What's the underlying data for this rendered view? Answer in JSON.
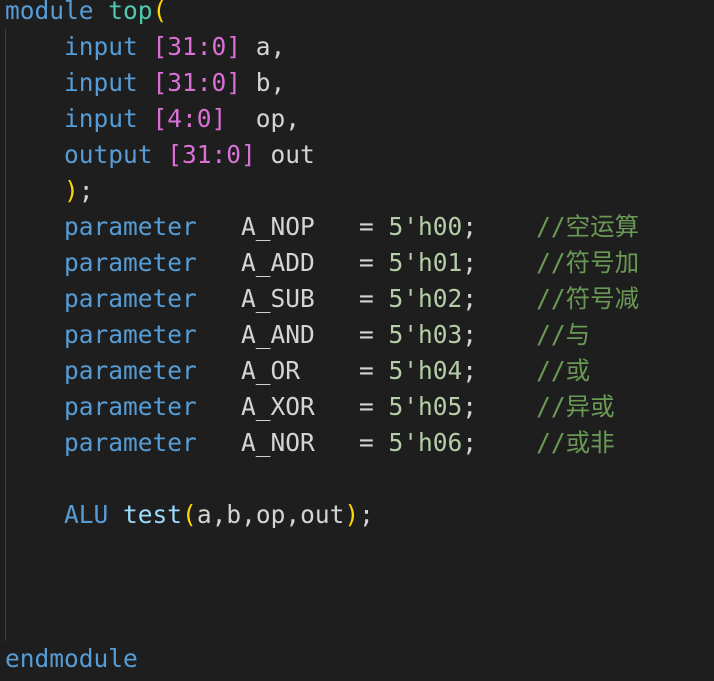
{
  "editor": {
    "lines": [
      {
        "tokens": [
          {
            "text": "module ",
            "color": "#569cd6"
          },
          {
            "text": "top",
            "color": "#4ec9b0"
          },
          {
            "text": "(",
            "color": "#ffd700"
          }
        ]
      },
      {
        "tokens": [
          {
            "text": "    input ",
            "color": "#569cd6"
          },
          {
            "text": "[31:0]",
            "color": "#da70d6"
          },
          {
            "text": " a,",
            "color": "#d4d4d4"
          }
        ]
      },
      {
        "tokens": [
          {
            "text": "    input ",
            "color": "#569cd6"
          },
          {
            "text": "[31:0]",
            "color": "#da70d6"
          },
          {
            "text": " b,",
            "color": "#d4d4d4"
          }
        ]
      },
      {
        "tokens": [
          {
            "text": "    input ",
            "color": "#569cd6"
          },
          {
            "text": "[4:0]",
            "color": "#da70d6"
          },
          {
            "text": "  op,",
            "color": "#d4d4d4"
          }
        ]
      },
      {
        "tokens": [
          {
            "text": "    output ",
            "color": "#569cd6"
          },
          {
            "text": "[31:0]",
            "color": "#da70d6"
          },
          {
            "text": " out",
            "color": "#d4d4d4"
          }
        ]
      },
      {
        "tokens": [
          {
            "text": "    )",
            "color": "#ffd700"
          },
          {
            "text": ";",
            "color": "#d4d4d4"
          }
        ]
      },
      {
        "tokens": [
          {
            "text": "    parameter",
            "color": "#569cd6"
          },
          {
            "text": "   A_NOP   = ",
            "color": "#d4d4d4"
          },
          {
            "text": "5'h00",
            "color": "#b5cea8"
          },
          {
            "text": ";    ",
            "color": "#d4d4d4"
          },
          {
            "text": "//空运算",
            "color": "#6a9955"
          }
        ]
      },
      {
        "tokens": [
          {
            "text": "    parameter",
            "color": "#569cd6"
          },
          {
            "text": "   A_ADD   = ",
            "color": "#d4d4d4"
          },
          {
            "text": "5'h01",
            "color": "#b5cea8"
          },
          {
            "text": ";    ",
            "color": "#d4d4d4"
          },
          {
            "text": "//符号加",
            "color": "#6a9955"
          }
        ]
      },
      {
        "tokens": [
          {
            "text": "    parameter",
            "color": "#569cd6"
          },
          {
            "text": "   A_SUB   = ",
            "color": "#d4d4d4"
          },
          {
            "text": "5'h02",
            "color": "#b5cea8"
          },
          {
            "text": ";    ",
            "color": "#d4d4d4"
          },
          {
            "text": "//符号减",
            "color": "#6a9955"
          }
        ]
      },
      {
        "tokens": [
          {
            "text": "    parameter",
            "color": "#569cd6"
          },
          {
            "text": "   A_AND   = ",
            "color": "#d4d4d4"
          },
          {
            "text": "5'h03",
            "color": "#b5cea8"
          },
          {
            "text": ";    ",
            "color": "#d4d4d4"
          },
          {
            "text": "//与",
            "color": "#6a9955"
          }
        ]
      },
      {
        "tokens": [
          {
            "text": "    parameter",
            "color": "#569cd6"
          },
          {
            "text": "   A_OR    = ",
            "color": "#d4d4d4"
          },
          {
            "text": "5'h04",
            "color": "#b5cea8"
          },
          {
            "text": ";    ",
            "color": "#d4d4d4"
          },
          {
            "text": "//或",
            "color": "#6a9955"
          }
        ]
      },
      {
        "tokens": [
          {
            "text": "    parameter",
            "color": "#569cd6"
          },
          {
            "text": "   A_XOR   = ",
            "color": "#d4d4d4"
          },
          {
            "text": "5'h05",
            "color": "#b5cea8"
          },
          {
            "text": ";    ",
            "color": "#d4d4d4"
          },
          {
            "text": "//异或",
            "color": "#6a9955"
          }
        ]
      },
      {
        "tokens": [
          {
            "text": "    parameter",
            "color": "#569cd6"
          },
          {
            "text": "   A_NOR   = ",
            "color": "#d4d4d4"
          },
          {
            "text": "5'h06",
            "color": "#b5cea8"
          },
          {
            "text": ";    ",
            "color": "#d4d4d4"
          },
          {
            "text": "//或非",
            "color": "#6a9955"
          }
        ]
      },
      {
        "tokens": []
      },
      {
        "tokens": [
          {
            "text": "    ALU",
            "color": "#569cd6"
          },
          {
            "text": " ",
            "color": "#d4d4d4"
          },
          {
            "text": "test",
            "color": "#9cdcfe"
          },
          {
            "text": "(",
            "color": "#ffd700"
          },
          {
            "text": "a,b,op,out",
            "color": "#d4d4d4"
          },
          {
            "text": ")",
            "color": "#ffd700"
          },
          {
            "text": ";",
            "color": "#d4d4d4"
          }
        ]
      },
      {
        "tokens": []
      },
      {
        "tokens": []
      },
      {
        "tokens": []
      },
      {
        "tokens": [
          {
            "text": "endmodule",
            "color": "#569cd6"
          }
        ]
      }
    ]
  }
}
